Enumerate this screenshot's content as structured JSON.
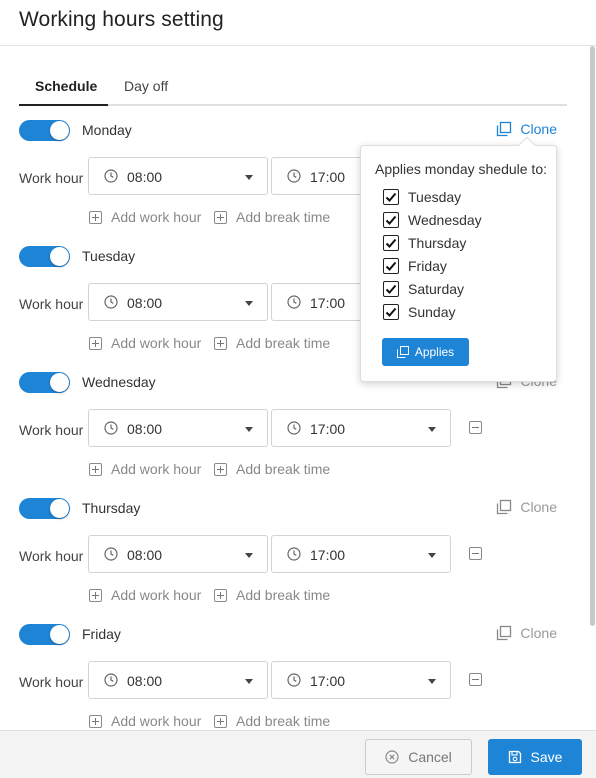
{
  "title": "Working hours setting",
  "tabs": [
    {
      "label": "Schedule",
      "active": true
    },
    {
      "label": "Day off",
      "active": false
    }
  ],
  "work_hour_label": "Work hour",
  "add_work_hour_label": "Add work hour",
  "add_break_time_label": "Add break time",
  "clone_label": "Clone",
  "days": [
    {
      "name": "Monday",
      "enabled": true,
      "start": "08:00",
      "end": "17:00"
    },
    {
      "name": "Tuesday",
      "enabled": true,
      "start": "08:00",
      "end": "17:00"
    },
    {
      "name": "Wednesday",
      "enabled": true,
      "start": "08:00",
      "end": "17:00"
    },
    {
      "name": "Thursday",
      "enabled": true,
      "start": "08:00",
      "end": "17:00"
    },
    {
      "name": "Friday",
      "enabled": true,
      "start": "08:00",
      "end": "17:00"
    }
  ],
  "popover": {
    "title": "Applies monday shedule to:",
    "options": [
      {
        "label": "Tuesday",
        "checked": true
      },
      {
        "label": "Wednesday",
        "checked": true
      },
      {
        "label": "Thursday",
        "checked": true
      },
      {
        "label": "Friday",
        "checked": true
      },
      {
        "label": "Saturday",
        "checked": true
      },
      {
        "label": "Sunday",
        "checked": true
      }
    ],
    "apply_label": "Applies"
  },
  "footer": {
    "cancel_label": "Cancel",
    "save_label": "Save"
  },
  "colors": {
    "accent": "#1e84d6",
    "footer_bg": "#f3f3f3"
  }
}
